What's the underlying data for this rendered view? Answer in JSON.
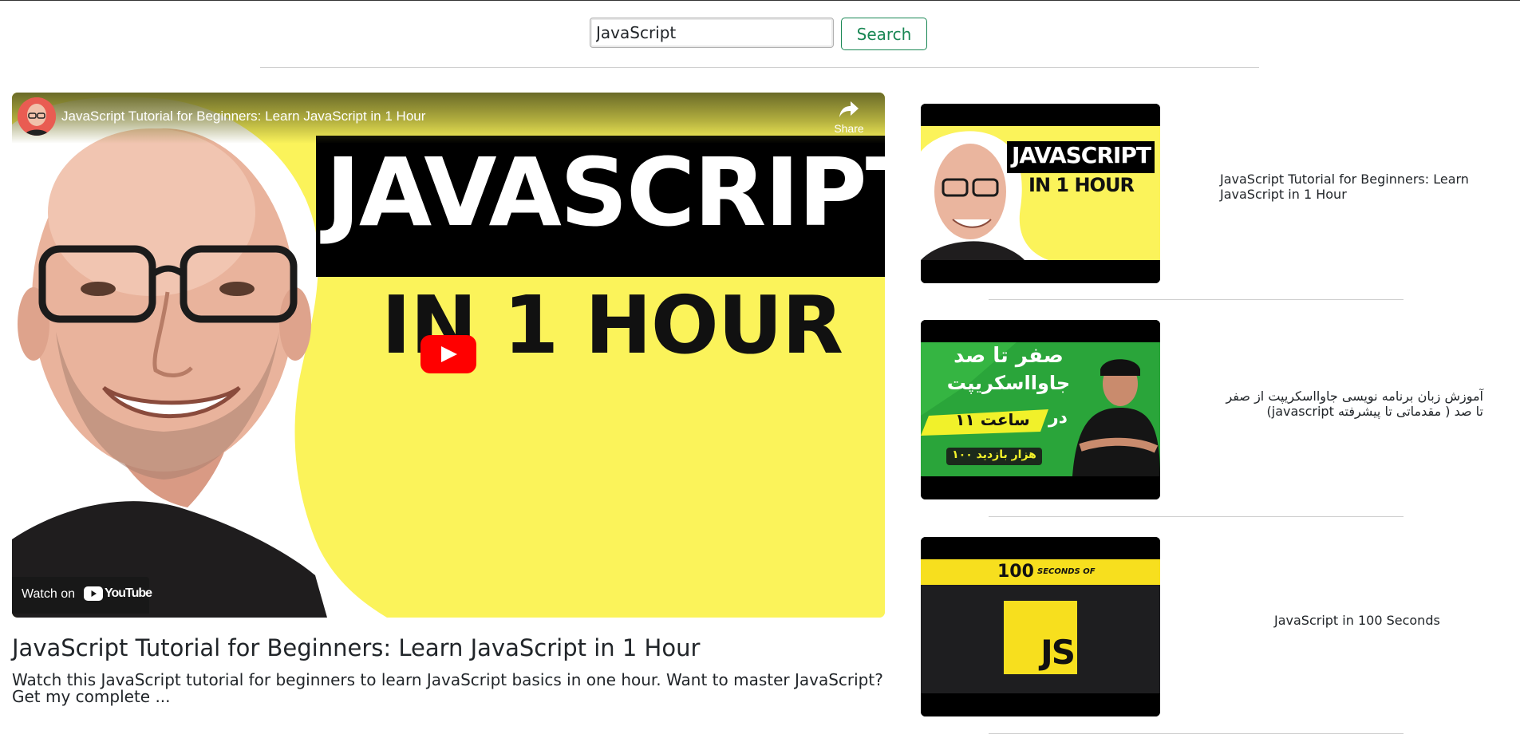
{
  "search": {
    "value": "JavaScript",
    "button_label": "Search"
  },
  "player": {
    "overlay_title": "JavaScript Tutorial for Beginners: Learn JavaScript in 1 Hour",
    "share_label": "Share",
    "watch_on_label": "Watch on",
    "youtube_wordmark": "YouTube",
    "thumbnail_text_line1": "JAVASCRIPT",
    "thumbnail_text_line2": "IN 1 HOUR",
    "colors": {
      "thumbnail_yellow": "#fbf35a",
      "play_red": "#ff0000"
    }
  },
  "main": {
    "title": "JavaScript Tutorial for Beginners: Learn JavaScript in 1 Hour",
    "description": "Watch this JavaScript tutorial for beginners to learn JavaScript basics in one hour. Want to master JavaScript? Get my complete ..."
  },
  "sidebar": {
    "items": [
      {
        "title": "JavaScript Tutorial for Beginners: Learn JavaScript in 1 Hour",
        "thumb_line1": "JAVASCRIPT",
        "thumb_line2": "IN 1 HOUR"
      },
      {
        "title": "آموزش زبان برنامه نویسی جاوااسکریپت از صفر تا صد ( مقدماتی تا پیشرفته javascript)",
        "thumb_line1": "صفر تا صد",
        "thumb_line2": "جاوااسکریپت",
        "thumb_line3": "در",
        "thumb_line4": "۱۱ ساعت",
        "thumb_line5": "۱۰۰ هزار بازدید"
      },
      {
        "title": "JavaScript in 100 Seconds",
        "thumb_number": "100",
        "thumb_caption": "SECONDS OF",
        "thumb_logo": "JS"
      }
    ]
  }
}
